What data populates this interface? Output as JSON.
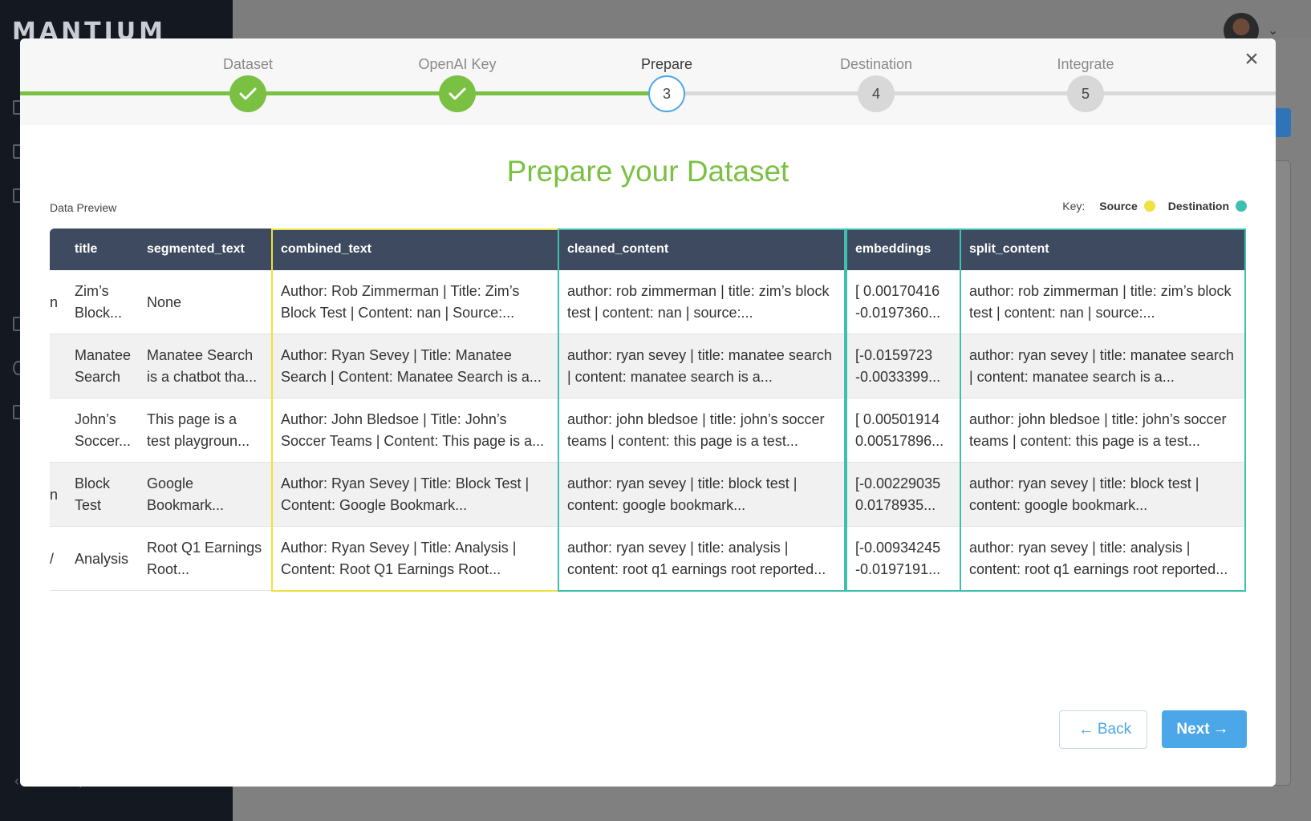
{
  "background": {
    "logo": "MANTIUM",
    "collapse_label": "Collapse"
  },
  "stepper": {
    "steps": [
      {
        "label": "Dataset",
        "number": "",
        "state": "done"
      },
      {
        "label": "OpenAI Key",
        "number": "",
        "state": "done"
      },
      {
        "label": "Prepare",
        "number": "3",
        "state": "current"
      },
      {
        "label": "Destination",
        "number": "4",
        "state": "todo"
      },
      {
        "label": "Integrate",
        "number": "5",
        "state": "todo"
      }
    ],
    "close_glyph": "×"
  },
  "title": "Prepare your Dataset",
  "data_preview_label": "Data Preview",
  "key": {
    "label": "Key:",
    "source": "Source",
    "destination": "Destination",
    "source_color": "#f0e040",
    "destination_color": "#3fbfae"
  },
  "table": {
    "columns": [
      "title",
      "segmented_text",
      "combined_text",
      "cleaned_content",
      "embeddings",
      "split_content"
    ],
    "rows": [
      {
        "edge": "n",
        "cells": [
          "Zim’s Block...",
          "None",
          "Author: Rob Zimmerman | Title: Zim’s Block Test | Content: nan | Source:...",
          "author: rob zimmerman | title: zim’s block test | content: nan | source:...",
          "[ 0.00170416 -0.0197360...",
          "author: rob zimmerman | title: zim’s block test | content: nan | source:..."
        ]
      },
      {
        "edge": "",
        "cells": [
          "Manatee Search",
          "Manatee Search is a chatbot tha...",
          "Author: Ryan Sevey | Title: Manatee Search | Content: Manatee Search is a...",
          "author: ryan sevey | title: manatee search | content: manatee search is a...",
          "[-0.0159723 -0.0033399...",
          "author: ryan sevey | title: manatee search | content: manatee search is a..."
        ]
      },
      {
        "edge": "",
        "cells": [
          "John’s Soccer...",
          "This page is a test playgroun...",
          "Author: John Bledsoe | Title: John’s Soccer Teams | Content: This page is a...",
          "author: john bledsoe | title: john’s soccer teams | content: this page is a test...",
          "[ 0.00501914 0.00517896...",
          "author: john bledsoe | title: john’s soccer teams | content: this page is a test..."
        ]
      },
      {
        "edge": "n",
        "cells": [
          "Block Test",
          "Google Bookmark...",
          "Author: Ryan Sevey | Title: Block Test | Content: Google Bookmark...",
          "author: ryan sevey | title: block test | content: google bookmark...",
          "[-0.00229035 0.0178935...",
          "author: ryan sevey | title: block test | content: google bookmark..."
        ]
      },
      {
        "edge": "/",
        "cells": [
          "Analysis",
          "Root Q1 Earnings Root...",
          "Author: Ryan Sevey | Title: Analysis | Content: Root Q1 Earnings Root...",
          "author: ryan sevey | title: analysis | content: root q1 earnings root reported...",
          "[-0.00934245 -0.0197191...",
          "author: ryan sevey | title: analysis | content: root q1 earnings root reported..."
        ]
      }
    ]
  },
  "buttons": {
    "back": "Back",
    "next": "Next",
    "back_arrow": "←",
    "next_arrow": "→"
  }
}
